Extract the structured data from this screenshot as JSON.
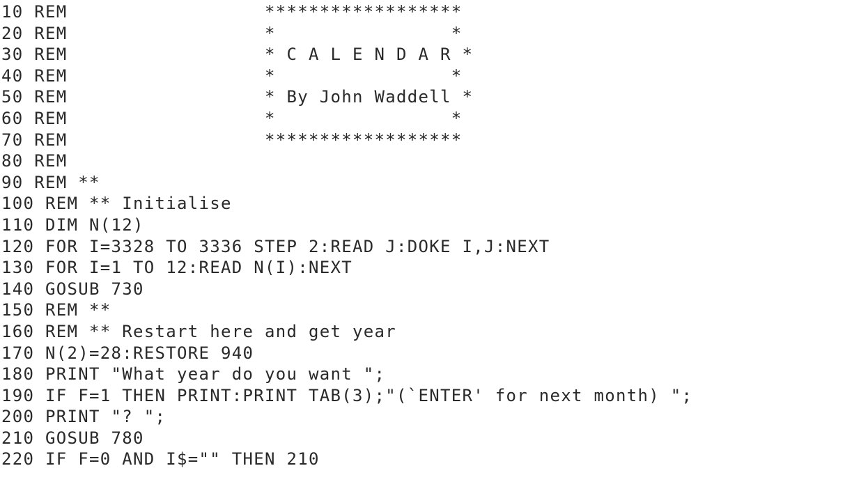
{
  "listing": {
    "lines": [
      "10 REM                  ******************",
      "20 REM                  *                *",
      "30 REM                  * C A L E N D A R *",
      "40 REM                  *                *",
      "50 REM                  * By John Waddell *",
      "60 REM                  *                *",
      "70 REM                  ******************",
      "80 REM",
      "90 REM **",
      "100 REM ** Initialise",
      "110 DIM N(12)",
      "120 FOR I=3328 TO 3336 STEP 2:READ J:DOKE I,J:NEXT",
      "130 FOR I=1 TO 12:READ N(I):NEXT",
      "140 GOSUB 730",
      "150 REM **",
      "160 REM ** Restart here and get year",
      "170 N(2)=28:RESTORE 940",
      "180 PRINT \"What year do you want \";",
      "190 IF F=1 THEN PRINT:PRINT TAB(3);\"(`ENTER' for next month) \";",
      "200 PRINT \"? \";",
      "210 GOSUB 780",
      "220 IF F=0 AND I$=\"\" THEN 210"
    ]
  }
}
